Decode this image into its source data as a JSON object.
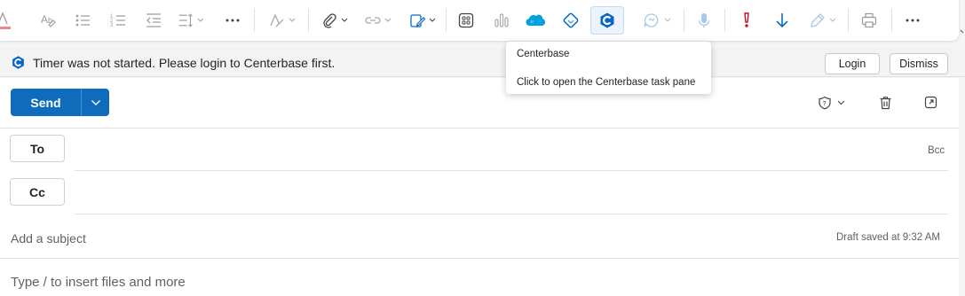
{
  "toolbar": {
    "items": [
      {
        "name": "font-color-icon"
      },
      {
        "name": "clear-formatting-icon"
      },
      {
        "name": "bullets-icon"
      },
      {
        "name": "numbering-icon"
      },
      {
        "name": "decrease-indent-icon"
      },
      {
        "name": "line-spacing-icon"
      },
      {
        "name": "more-formatting-icon"
      },
      {
        "name": "styles-icon"
      },
      {
        "name": "attach-file-icon"
      },
      {
        "name": "link-icon"
      },
      {
        "name": "signature-icon"
      },
      {
        "name": "apps-icon"
      },
      {
        "name": "viva-insights-icon"
      },
      {
        "name": "salesforce-icon"
      },
      {
        "name": "loop-icon"
      },
      {
        "name": "centerbase-icon"
      },
      {
        "name": "copilot-icon"
      },
      {
        "name": "dictate-icon"
      },
      {
        "name": "high-importance-icon"
      },
      {
        "name": "low-importance-icon"
      },
      {
        "name": "sensitivity-icon"
      },
      {
        "name": "print-icon"
      },
      {
        "name": "more-options-icon"
      }
    ]
  },
  "infobar": {
    "message": "Timer was not started. Please login to Centerbase first.",
    "login_label": "Login",
    "dismiss_label": "Dismiss"
  },
  "compose": {
    "send_label": "Send",
    "to_label": "To",
    "cc_label": "Cc",
    "bcc_label": "Bcc",
    "subject_placeholder": "Add a subject",
    "draft_status": "Draft saved at 9:32 AM",
    "body_placeholder": "Type / to insert files and more"
  },
  "tooltip": {
    "title": "Centerbase",
    "description": "Click to open the Centerbase task pane"
  },
  "colors": {
    "accent": "#0f6cbd",
    "centerbase_blue": "#0a66c2",
    "importance_red": "#c50f1f",
    "salesforce_blue": "#00a1e0"
  }
}
